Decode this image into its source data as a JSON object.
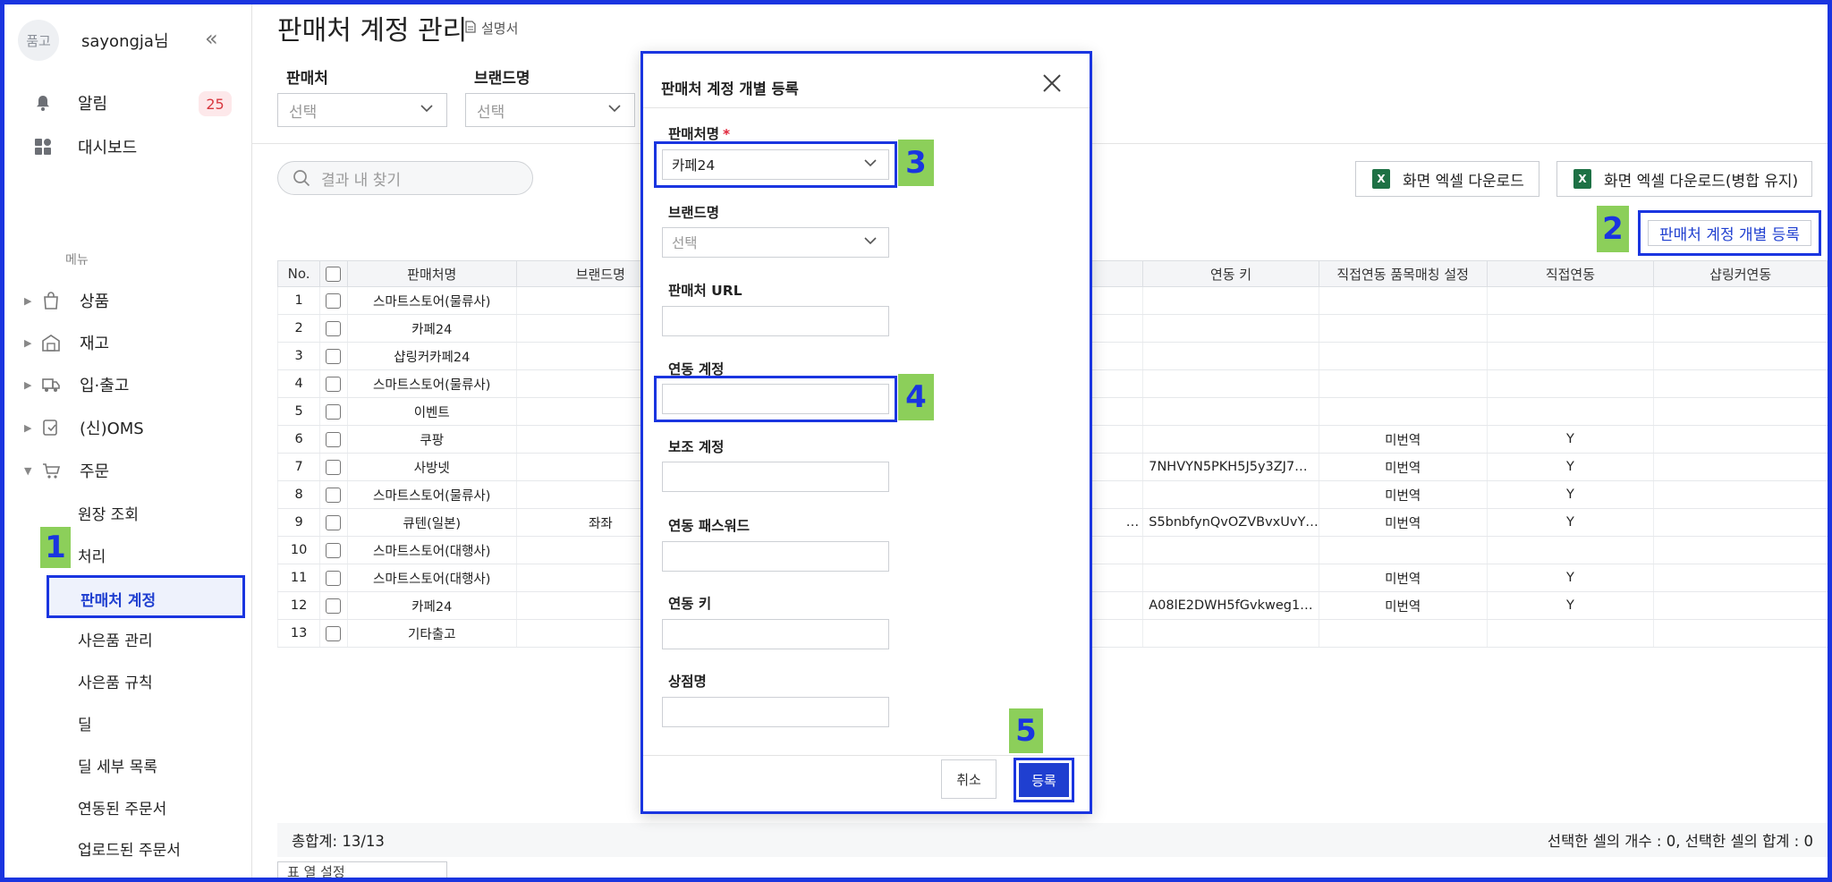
{
  "sidebar": {
    "avatar_text": "품고",
    "username": "sayongja님",
    "collapse_icon": "«",
    "notifications": {
      "label": "알림",
      "count": "25"
    },
    "dashboard": {
      "label": "대시보드"
    },
    "menu_title": "메뉴",
    "menu": [
      {
        "label": "상품",
        "icon": "bag-icon"
      },
      {
        "label": "재고",
        "icon": "warehouse-icon"
      },
      {
        "label": "입·출고",
        "icon": "truck-icon"
      },
      {
        "label": "(신)OMS",
        "icon": "oms-icon"
      },
      {
        "label": "주문",
        "icon": "cart-icon"
      }
    ],
    "sub_items": [
      "원장 조회",
      "처리",
      "판매처 계정",
      "사은품 관리",
      "사은품 규칙",
      "딜",
      "딜 세부 목록",
      "연동된 주문서",
      "업로드된 주문서"
    ],
    "active_sub": "판매처 계정"
  },
  "callouts": [
    "1",
    "2",
    "3",
    "4",
    "5"
  ],
  "header": {
    "title": "판매처 계정 관리",
    "doc_link": "설명서"
  },
  "filters": {
    "seller_label": "판매처",
    "seller_value": "선택",
    "brand_label": "브랜드명",
    "brand_value": "선택"
  },
  "toolbar": {
    "search_placeholder": "결과 내 찾기",
    "excel_download": "화면 엑셀 다운로드",
    "excel_download_merged": "화면 엑셀 다운로드(병합 유지)",
    "register_button": "판매처 계정 개별 등록"
  },
  "table": {
    "columns": [
      "No.",
      "",
      "판매처명",
      "브랜드명",
      "",
      "연동 키",
      "직접연동 품목매칭 설정",
      "직접연동",
      "샵링커연동"
    ],
    "rows": [
      {
        "no": "1",
        "seller": "스마트스토어(물류사)",
        "brand": "",
        "hidden": "",
        "key": "",
        "match": "",
        "direct": "",
        "shoplinker": ""
      },
      {
        "no": "2",
        "seller": "카페24",
        "brand": "",
        "hidden": "",
        "key": "",
        "match": "",
        "direct": "",
        "shoplinker": ""
      },
      {
        "no": "3",
        "seller": "샵링커카페24",
        "brand": "",
        "hidden": "",
        "key": "",
        "match": "",
        "direct": "",
        "shoplinker": ""
      },
      {
        "no": "4",
        "seller": "스마트스토어(물류사)",
        "brand": "",
        "hidden": "",
        "key": "",
        "match": "",
        "direct": "",
        "shoplinker": ""
      },
      {
        "no": "5",
        "seller": "이벤트",
        "brand": "",
        "hidden": "",
        "key": "",
        "match": "",
        "direct": "",
        "shoplinker": ""
      },
      {
        "no": "6",
        "seller": "쿠팡",
        "brand": "",
        "hidden": "",
        "key": "",
        "match": "미번역",
        "direct": "Y",
        "shoplinker": ""
      },
      {
        "no": "7",
        "seller": "사방넷",
        "brand": "",
        "hidden": "",
        "key": "7NHVYN5PKH5J5y3ZJ7…",
        "match": "미번역",
        "direct": "Y",
        "shoplinker": ""
      },
      {
        "no": "8",
        "seller": "스마트스토어(물류사)",
        "brand": "",
        "hidden": "",
        "key": "",
        "match": "미번역",
        "direct": "Y",
        "shoplinker": ""
      },
      {
        "no": "9",
        "seller": "큐텐(일본)",
        "brand": "좌좌",
        "hidden": "…",
        "key": "S5bnbfynQvOZVBvxUvY…",
        "match": "미번역",
        "direct": "Y",
        "shoplinker": ""
      },
      {
        "no": "10",
        "seller": "스마트스토어(대행사)",
        "brand": "",
        "hidden": "",
        "key": "",
        "match": "",
        "direct": "",
        "shoplinker": ""
      },
      {
        "no": "11",
        "seller": "스마트스토어(대행사)",
        "brand": "",
        "hidden": "",
        "key": "",
        "match": "미번역",
        "direct": "Y",
        "shoplinker": ""
      },
      {
        "no": "12",
        "seller": "카페24",
        "brand": "",
        "hidden": "",
        "key": "A08lE2DWH5fGvkweg1…",
        "match": "미번역",
        "direct": "Y",
        "shoplinker": ""
      },
      {
        "no": "13",
        "seller": "기타출고",
        "brand": "",
        "hidden": "",
        "key": "",
        "match": "",
        "direct": "",
        "shoplinker": ""
      }
    ]
  },
  "footer": {
    "total": "총합계: 13/13",
    "selection": "선택한 셀의 개수 : 0, 선택한 셀의 합계 : 0",
    "column_settings": "표 열 설정"
  },
  "modal": {
    "title": "판매처 계정 개별 등록",
    "seller_label": "판매처명",
    "required_mark": "*",
    "seller_value": "카페24",
    "brand_label": "브랜드명",
    "brand_placeholder": "선택",
    "url_label": "판매처 URL",
    "account_label": "연동 계정",
    "sub_account_label": "보조 계정",
    "password_label": "연동 패스워드",
    "key_label": "연동 키",
    "store_label": "상점명",
    "cancel": "취소",
    "submit": "등록"
  },
  "colors": {
    "accent": "#1a35e0",
    "callout": "#8ccf5a",
    "badge_bg": "#fde8ea",
    "badge_text": "#d8383f",
    "excel": "#1e7145"
  }
}
